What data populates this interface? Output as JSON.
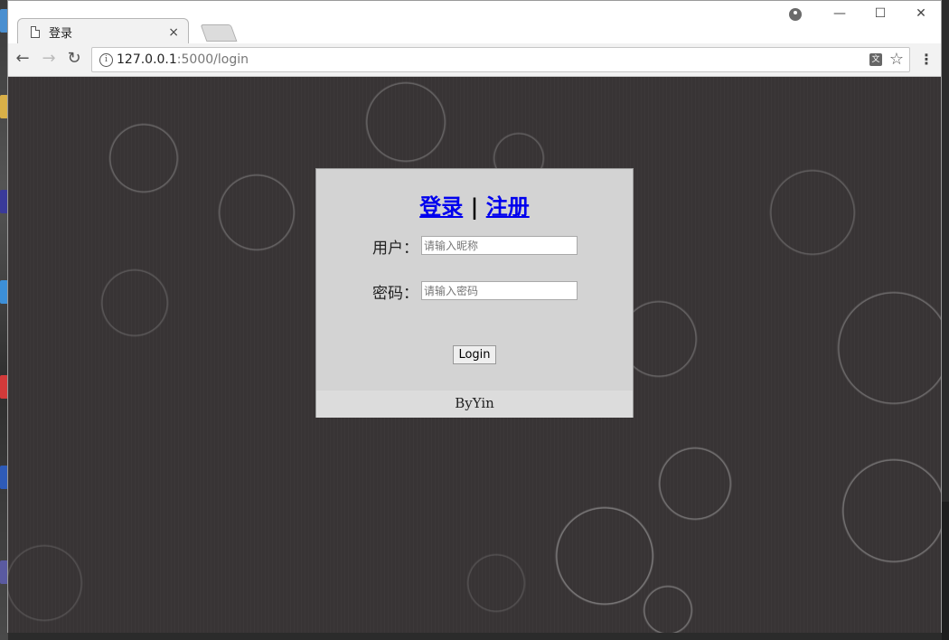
{
  "browser": {
    "tab": {
      "title": "登录",
      "close": "×"
    },
    "window_controls": {
      "minimize": "—",
      "maximize": "☐",
      "close": "✕"
    },
    "nav": {
      "back": "←",
      "forward": "→",
      "reload": "↻"
    },
    "url": {
      "host": "127.0.0.1",
      "rest": ":5000/login"
    },
    "menu": "⋮",
    "star": "☆",
    "translate": "文"
  },
  "login": {
    "link_login": "登录",
    "separator": "|",
    "link_register": "注册",
    "username_label": "用户：",
    "username_placeholder": "请输入昵称",
    "password_label": "密码：",
    "password_placeholder": "请输入密码",
    "submit_label": "Login",
    "footer": "ByYin"
  }
}
